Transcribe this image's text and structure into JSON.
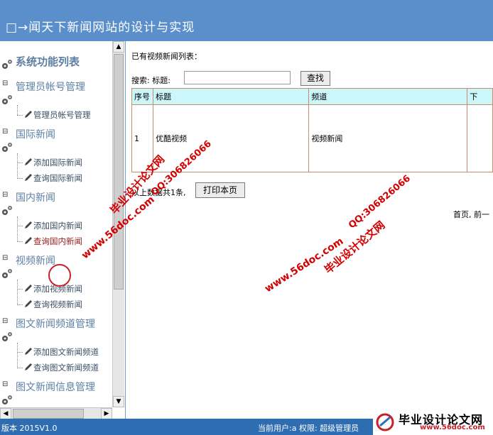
{
  "header": {
    "title": "□→闻天下新闻网站的设计与实现"
  },
  "sidebar": {
    "system_title": "系统功能列表",
    "groups": [
      {
        "title": "管理员帐号管理",
        "items": [
          "管理员帐号管理"
        ]
      },
      {
        "title": "国际新闻",
        "items": [
          "添加国际新闻",
          "查询国际新闻"
        ]
      },
      {
        "title": "国内新闻",
        "items": [
          "添加国内新闻",
          "查询国内新闻"
        ]
      },
      {
        "title": "视频新闻",
        "items": [
          "添加视频新闻",
          "查询视频新闻"
        ]
      },
      {
        "title": "图文新闻频道管理",
        "items": [
          "添加图文新闻频道",
          "查询图文新闻频道"
        ]
      },
      {
        "title": "图文新闻信息管理",
        "items": []
      }
    ]
  },
  "main": {
    "list_title": "已有视频新闻列表：",
    "search_label": "搜索: 标题:",
    "search_value": "",
    "find_button": "查找",
    "table": {
      "headers": [
        "序号",
        "标题",
        "频道",
        "下"
      ],
      "rows": [
        [
          "1",
          "优酷视频",
          "视频新闻",
          ""
        ]
      ]
    },
    "total_text": "以上数据共1条,",
    "print_button": "打印本页",
    "pager": "首页, 前一"
  },
  "footer": {
    "version": "版本 2015V1.0",
    "user_info": "当前用户:a 权限: 超级管理员"
  },
  "watermarks": {
    "site": "www.56doc.com",
    "cn": "毕业设计论文网",
    "qq": "QQ:306826066",
    "badge_cn": "毕业设计论文网",
    "badge_site": "www.56doc.com"
  },
  "colors": {
    "header_bg": "#5b8fcb",
    "footer_bg": "#2e6db1",
    "table_header_bg": "#cbf7fb",
    "watermark": "#d40000"
  }
}
